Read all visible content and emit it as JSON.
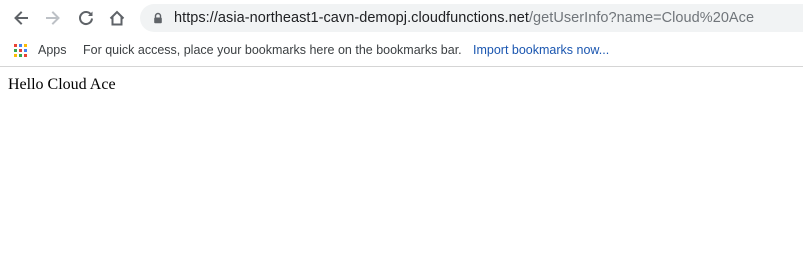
{
  "browser": {
    "address_bar": {
      "url_host": "https://asia-northeast1-cavn-demopj.cloudfunctions.net",
      "url_path": "/getUserInfo?name=Cloud%20Ace"
    },
    "bookmarks_bar": {
      "apps_label": "Apps",
      "hint_text": "For quick access, place your bookmarks here on the bookmarks bar.",
      "import_link": "Import bookmarks now..."
    },
    "icons": {
      "back": "back-arrow-icon",
      "forward": "forward-arrow-icon",
      "reload": "reload-icon",
      "home": "home-icon",
      "lock": "lock-icon",
      "apps": "apps-grid-icon"
    },
    "colors": {
      "icon_active": "#5f6368",
      "icon_disabled": "#bdc1c6",
      "link": "#1a56b0",
      "omnibox_bg": "#f1f3f4"
    }
  },
  "page": {
    "body_text": "Hello Cloud Ace"
  }
}
